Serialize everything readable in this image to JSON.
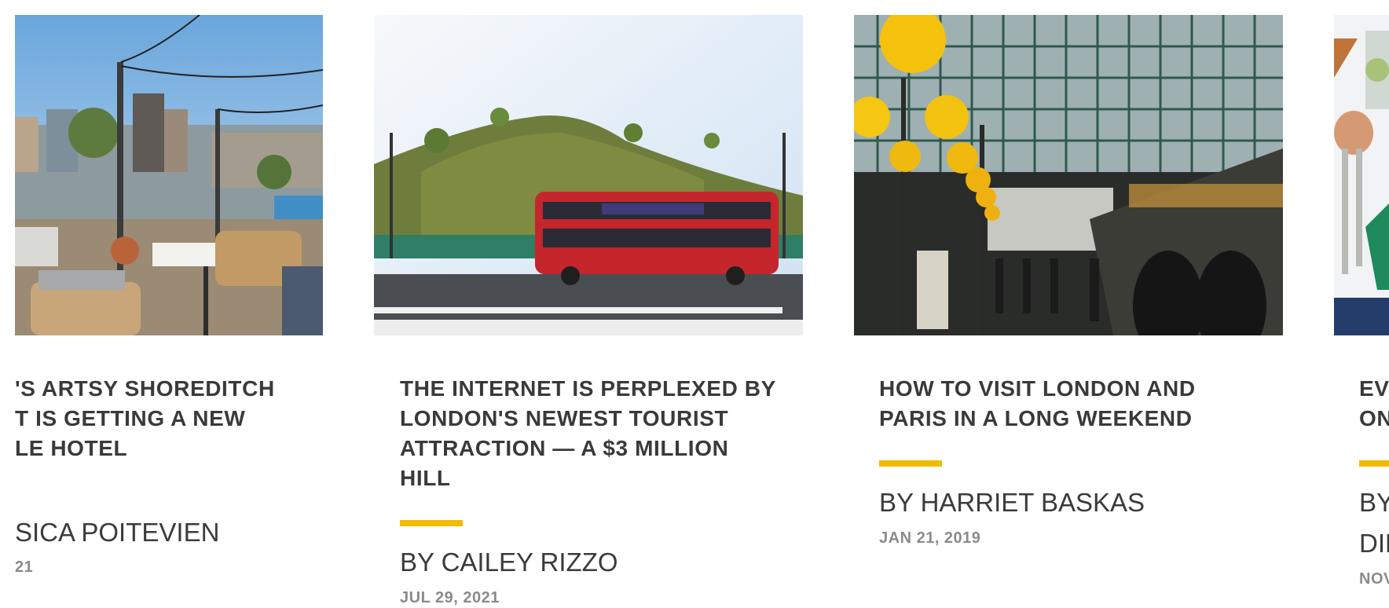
{
  "articles": [
    {
      "title_lines": [
        "'S ARTSY SHOREDITCH",
        "T IS GETTING A NEW",
        "LE HOTEL"
      ],
      "author": "SICA POITEVIEN",
      "date": "21"
    },
    {
      "title_lines": [
        "THE INTERNET IS PERPLEXED BY",
        "LONDON'S NEWEST TOURIST",
        "ATTRACTION — A $3 MILLION",
        "HILL"
      ],
      "author": "BY CAILEY RIZZO",
      "date": "JUL 29, 2021"
    },
    {
      "title_lines": [
        "HOW TO VISIT LONDON AND",
        "PARIS IN A LONG WEEKEND"
      ],
      "author": "BY HARRIET BASKAS",
      "date": "JAN 21, 2019"
    },
    {
      "title_lines": [
        "EV",
        "ON"
      ],
      "author": "BY",
      "author2": "DIE",
      "date": "NOV"
    }
  ],
  "colors": {
    "accent": "#f0bb00",
    "title": "#3a3a3a",
    "date": "#8b8b8b"
  }
}
